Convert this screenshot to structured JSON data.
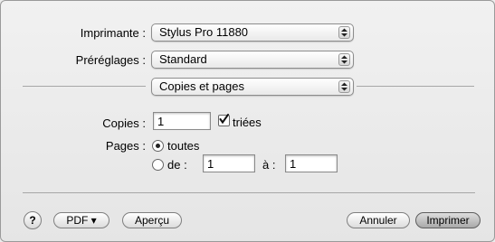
{
  "printer": {
    "label": "Imprimante :",
    "value": "Stylus Pro 11880"
  },
  "presets": {
    "label": "Préréglages :",
    "value": "Standard"
  },
  "section": {
    "value": "Copies et pages"
  },
  "copies": {
    "label": "Copies :",
    "value": "1",
    "collated_label": "triées",
    "collated": true
  },
  "pages": {
    "label": "Pages :",
    "all_label": "toutes",
    "range_label": "de :",
    "from_value": "1",
    "to_label": "à :",
    "to_value": "1",
    "selected": "all"
  },
  "footer": {
    "help_label": "?",
    "pdf_label": "PDF ▾",
    "preview_label": "Aperçu",
    "cancel_label": "Annuler",
    "print_label": "Imprimer"
  }
}
